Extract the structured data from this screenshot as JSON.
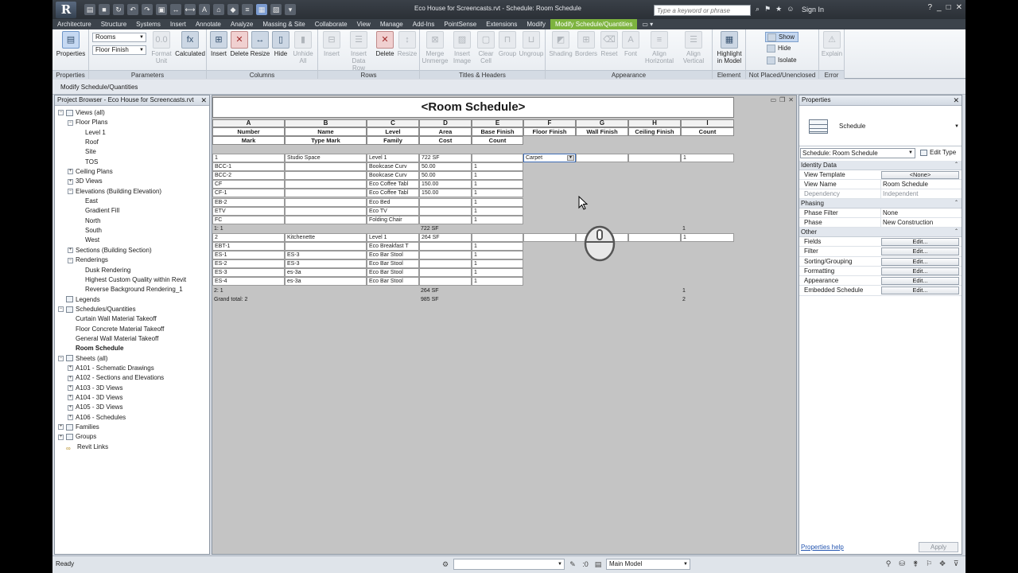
{
  "window": {
    "title": "Eco House for Screencasts.rvt - Schedule: Room Schedule",
    "search_placeholder": "Type a keyword or phrase",
    "sign_in": "Sign In"
  },
  "ribbon_tabs": [
    "Architecture",
    "Structure",
    "Systems",
    "Insert",
    "Annotate",
    "Analyze",
    "Massing & Site",
    "Collaborate",
    "View",
    "Manage",
    "Add-Ins",
    "PointSense",
    "Extensions",
    "Modify",
    "Modify Schedule/Quantities"
  ],
  "ribbon": {
    "properties_btn": "Properties",
    "params_dropdown1": "Rooms",
    "params_dropdown2": "Floor Finish",
    "format_unit": "Format Unit",
    "calculated": "Calculated",
    "col_insert": "Insert",
    "col_delete": "Delete",
    "col_resize": "Resize",
    "col_hide": "Hide",
    "col_unhide": "Unhide All",
    "row_insert": "Insert",
    "row_insert_data": "Insert Data Row",
    "row_delete": "Delete",
    "row_resize": "Resize",
    "merge": "Merge Unmerge",
    "insert_image": "Insert Image",
    "clear_cell": "Clear Cell",
    "group": "Group",
    "ungroup": "Ungroup",
    "shading": "Shading",
    "borders": "Borders",
    "reset": "Reset",
    "font": "Font",
    "align_h": "Align Horizontal",
    "align_v": "Align Vertical",
    "highlight": "Highlight in Model",
    "show": "Show",
    "hide": "Hide",
    "isolate": "Isolate",
    "explain": "Explain",
    "panels": {
      "properties": "Properties",
      "parameters": "Parameters",
      "columns": "Columns",
      "rows": "Rows",
      "titles": "Titles & Headers",
      "appearance": "Appearance",
      "element": "Element",
      "not_placed": "Not Placed/Unenclosed",
      "error": "Error"
    }
  },
  "options_bar": "Modify Schedule/Quantities",
  "project_browser": {
    "title": "Project Browser - Eco House for Screencasts.rvt",
    "nodes": [
      {
        "label": "Views (all)",
        "level": 0,
        "exp": "-",
        "icon": true
      },
      {
        "label": "Floor Plans",
        "level": 1,
        "exp": "-"
      },
      {
        "label": "Level 1",
        "level": 2
      },
      {
        "label": "Roof",
        "level": 2
      },
      {
        "label": "Site",
        "level": 2
      },
      {
        "label": "TOS",
        "level": 2
      },
      {
        "label": "Ceiling Plans",
        "level": 1,
        "exp": "+"
      },
      {
        "label": "3D Views",
        "level": 1,
        "exp": "+"
      },
      {
        "label": "Elevations (Building Elevation)",
        "level": 1,
        "exp": "-"
      },
      {
        "label": "East",
        "level": 2
      },
      {
        "label": "Gradient Fill",
        "level": 2
      },
      {
        "label": "North",
        "level": 2
      },
      {
        "label": "South",
        "level": 2
      },
      {
        "label": "West",
        "level": 2
      },
      {
        "label": "Sections (Building Section)",
        "level": 1,
        "exp": "+"
      },
      {
        "label": "Renderings",
        "level": 1,
        "exp": "-"
      },
      {
        "label": "Dusk Rendering",
        "level": 2
      },
      {
        "label": "Highest Custom Quality within Revit",
        "level": 2
      },
      {
        "label": "Reverse Background Rendering_1",
        "level": 2
      },
      {
        "label": "Legends",
        "level": 0,
        "icon": true
      },
      {
        "label": "Schedules/Quantities",
        "level": 0,
        "exp": "-",
        "icon": true
      },
      {
        "label": "Curtain Wall Material Takeoff",
        "level": 1
      },
      {
        "label": "Floor Concrete Material Takeoff",
        "level": 1
      },
      {
        "label": "General Wall Material Takeoff",
        "level": 1
      },
      {
        "label": "Room Schedule",
        "level": 1,
        "selected": true
      },
      {
        "label": "Sheets (all)",
        "level": 0,
        "exp": "-",
        "icon": true
      },
      {
        "label": "A101 - Schematic Drawings",
        "level": 1,
        "exp": "+"
      },
      {
        "label": "A102 - Sections and Elevations",
        "level": 1,
        "exp": "+"
      },
      {
        "label": "A103 - 3D Views",
        "level": 1,
        "exp": "+"
      },
      {
        "label": "A104 - 3D Views",
        "level": 1,
        "exp": "+"
      },
      {
        "label": "A105 - 3D Views",
        "level": 1,
        "exp": "+"
      },
      {
        "label": "A106 - Schedules",
        "level": 1,
        "exp": "+"
      },
      {
        "label": "Families",
        "level": 0,
        "exp": "+",
        "icon": true
      },
      {
        "label": "Groups",
        "level": 0,
        "exp": "+",
        "icon": true
      },
      {
        "label": "Revit Links",
        "level": 0,
        "link": true
      }
    ]
  },
  "schedule": {
    "title": "<Room Schedule>",
    "col_letters": [
      "A",
      "B",
      "C",
      "D",
      "E",
      "F",
      "G",
      "H",
      "I"
    ],
    "headers_top": [
      "Number",
      "Name",
      "Level",
      "Area",
      "Base Finish",
      "Floor Finish",
      "Wall Finish",
      "Ceiling Finish",
      "Count"
    ],
    "headers_bottom": [
      "Mark",
      "Type Mark",
      "Family",
      "Cost",
      "Count"
    ],
    "groups": [
      {
        "room": [
          "1",
          "Studio Space",
          "Level 1",
          "722 SF",
          "",
          "Carpet",
          "",
          "",
          "1"
        ],
        "items": [
          [
            "BCC-1",
            "",
            "Bookcase Curv",
            "50.00",
            "1"
          ],
          [
            "BCC-2",
            "",
            "Bookcase Curv",
            "50.00",
            "1"
          ],
          [
            "CF",
            "",
            "Eco Coffee Tabl",
            "150.00",
            "1"
          ],
          [
            "CF-1",
            "",
            "Eco Coffee Tabl",
            "150.00",
            "1"
          ],
          [
            "EB-2",
            "",
            "Eco Bed",
            "",
            "1"
          ],
          [
            "ETV",
            "",
            "Eco TV",
            "",
            "1"
          ],
          [
            "FC",
            "",
            "Folding Chair",
            "",
            "1"
          ]
        ],
        "subtotal": {
          "label": "1: 1",
          "area": "722 SF",
          "count": "1"
        }
      },
      {
        "room": [
          "2",
          "Kitchenette",
          "Level 1",
          "264 SF",
          "",
          "",
          "",
          "",
          "1"
        ],
        "items": [
          [
            "EBT-1",
            "",
            "Eco Breakfast T",
            "",
            "1"
          ],
          [
            "ES-1",
            "ES-3",
            "Eco Bar Stool",
            "",
            "1"
          ],
          [
            "ES-2",
            "ES-3",
            "Eco Bar Stool",
            "",
            "1"
          ],
          [
            "ES-3",
            "es-3a",
            "Eco Bar Stool",
            "",
            "1"
          ],
          [
            "ES-4",
            "es-3a",
            "Eco Bar Stool",
            "",
            "1"
          ]
        ],
        "subtotal": {
          "label": "2: 1",
          "area": "264 SF",
          "count": "1"
        }
      }
    ],
    "grand_total": {
      "label": "Grand total: 2",
      "area": "985 SF",
      "count": "2"
    }
  },
  "properties": {
    "title": "Properties",
    "type_name": "Schedule",
    "instance_filter": "Schedule: Room Schedule",
    "edit_type": "Edit Type",
    "categories": [
      {
        "name": "Identity Data",
        "rows": [
          {
            "name": "View Template",
            "value": "<None>",
            "button": true
          },
          {
            "name": "View Name",
            "value": "Room Schedule"
          },
          {
            "name": "Dependency",
            "value": "Independent",
            "dim": true
          }
        ]
      },
      {
        "name": "Phasing",
        "rows": [
          {
            "name": "Phase Filter",
            "value": "None"
          },
          {
            "name": "Phase",
            "value": "New Construction"
          }
        ]
      },
      {
        "name": "Other",
        "rows": [
          {
            "name": "Fields",
            "value": "Edit...",
            "button": true
          },
          {
            "name": "Filter",
            "value": "Edit...",
            "button": true
          },
          {
            "name": "Sorting/Grouping",
            "value": "Edit...",
            "button": true
          },
          {
            "name": "Formatting",
            "value": "Edit...",
            "button": true
          },
          {
            "name": "Appearance",
            "value": "Edit...",
            "button": true
          },
          {
            "name": "Embedded Schedule",
            "value": "Edit...",
            "button": true
          }
        ]
      }
    ],
    "help_link": "Properties help",
    "apply": "Apply"
  },
  "status": {
    "text": "Ready",
    "workset": "",
    "model": "Main Model"
  },
  "colors": {
    "context_tab": "#7db33f",
    "title_bar": "#2b3036",
    "drawing_bg": "#c4c4c4"
  }
}
